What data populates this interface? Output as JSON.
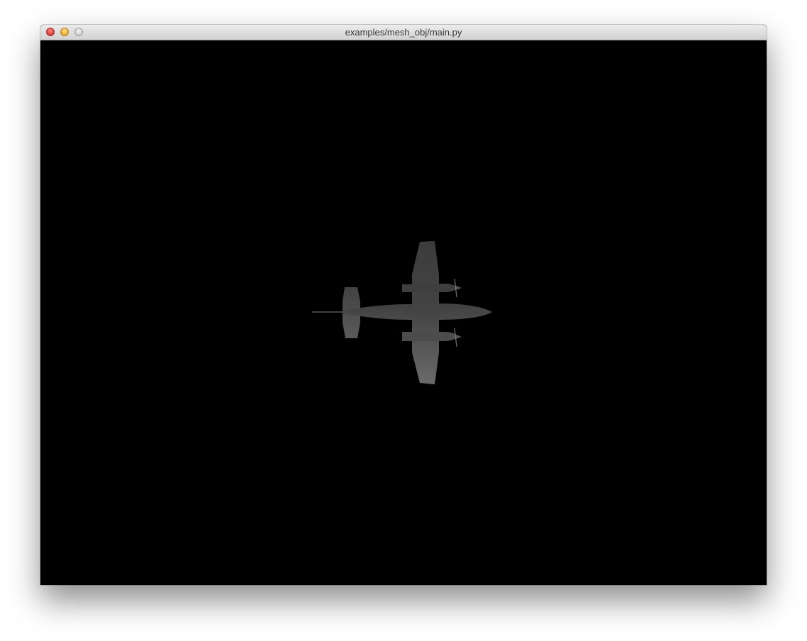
{
  "window": {
    "title": "examples/mesh_obj/main.py"
  },
  "titlebar_buttons": [
    {
      "name": "close",
      "color": "#e0443e"
    },
    {
      "name": "minimize",
      "color": "#f2b134"
    },
    {
      "name": "zoom",
      "color": "#cfcfcf"
    }
  ],
  "viewport": {
    "background": "#000000",
    "model_icon": "airplane-mesh",
    "model_color": "#4a4a4a"
  }
}
